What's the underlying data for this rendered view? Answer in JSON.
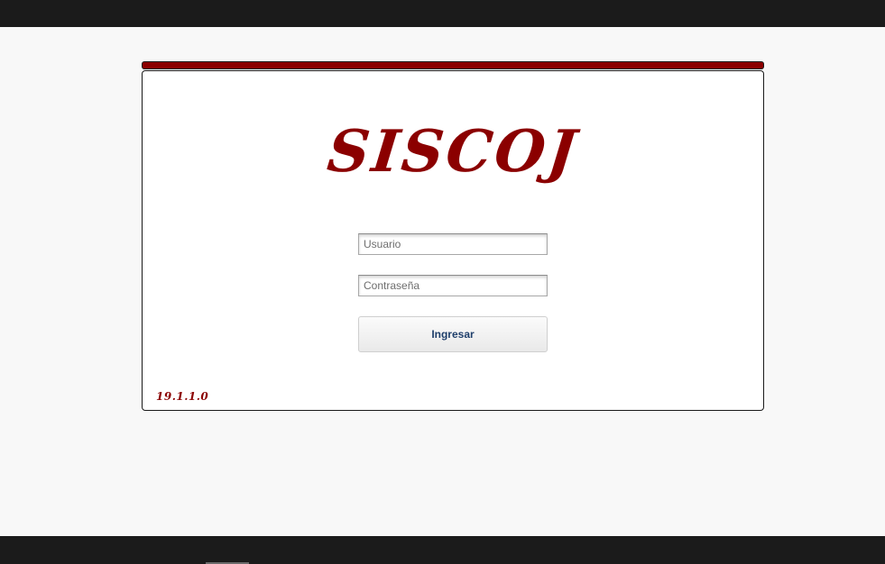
{
  "app": {
    "logo_text": "SISCOJ",
    "version": "19.1.1.0"
  },
  "login": {
    "username_placeholder": "Usuario",
    "username_value": "",
    "password_placeholder": "Contraseña",
    "password_value": "",
    "submit_label": "Ingresar"
  },
  "colors": {
    "brand": "#8b0000",
    "button_text": "#1f3f6b",
    "bars": "#1b1b1b",
    "background": "#f8f8f8"
  }
}
